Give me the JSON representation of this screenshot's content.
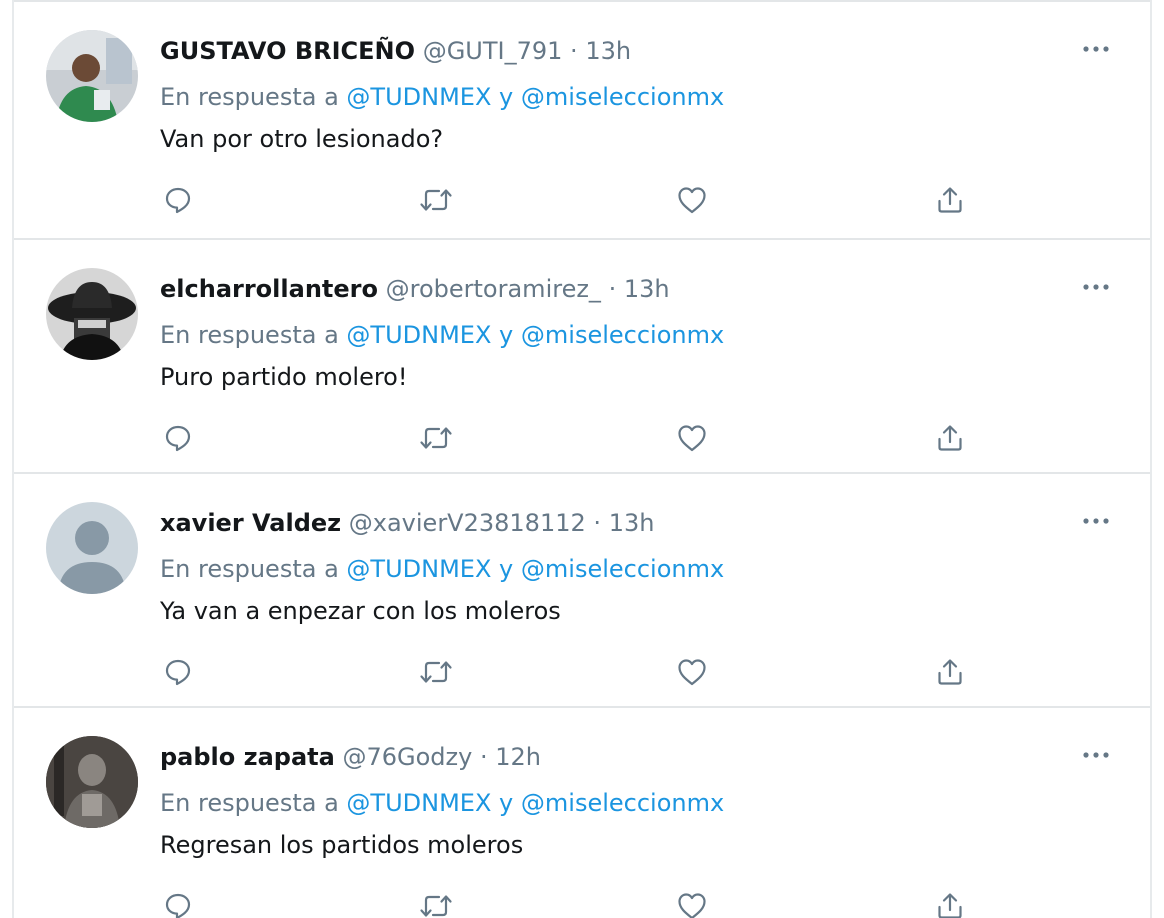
{
  "tweets": [
    {
      "name": "GUSTAVO BRICEÑO",
      "handle": "@GUTI_791",
      "dot": "·",
      "time": "13h",
      "reply_prefix": "En respuesta a",
      "mention1": "@TUDNMEX",
      "reply_and": "y",
      "mention2": "@miseleccionmx",
      "text": "Van por otro lesionado?",
      "avatar": "photo-person-green-shirt"
    },
    {
      "name": "elcharrollantero",
      "handle": "@robertoramirez_",
      "dot": "·",
      "time": "13h",
      "reply_prefix": "En respuesta a",
      "mention1": "@TUDNMEX",
      "reply_and": "y",
      "mention2": "@miseleccionmx",
      "text": "Puro partido molero!",
      "avatar": "photo-dark-charro-hat"
    },
    {
      "name": "xavier Valdez",
      "handle": "@xavierV23818112",
      "dot": "·",
      "time": "13h",
      "reply_prefix": "En respuesta a",
      "mention1": "@TUDNMEX",
      "reply_and": "y",
      "mention2": "@miseleccionmx",
      "text": "Ya van a enpezar con los moleros",
      "avatar": "default-profile-silhouette"
    },
    {
      "name": "pablo zapata",
      "handle": "@76Godzy",
      "dot": "·",
      "time": "12h",
      "reply_prefix": "En respuesta a",
      "mention1": "@TUDNMEX",
      "reply_and": "y",
      "mention2": "@miseleccionmx",
      "text": "Regresan los partidos moleros",
      "avatar": "photo-grey-figure"
    }
  ],
  "icons": {
    "reply": "reply-icon",
    "retweet": "retweet-icon",
    "like": "like-icon",
    "share": "share-icon",
    "more": "more-options-icon"
  },
  "colors": {
    "name": "#14171a",
    "muted": "#657786",
    "mention": "#1b95e0",
    "icon": "#657786",
    "divider": "#e3e6e8"
  }
}
